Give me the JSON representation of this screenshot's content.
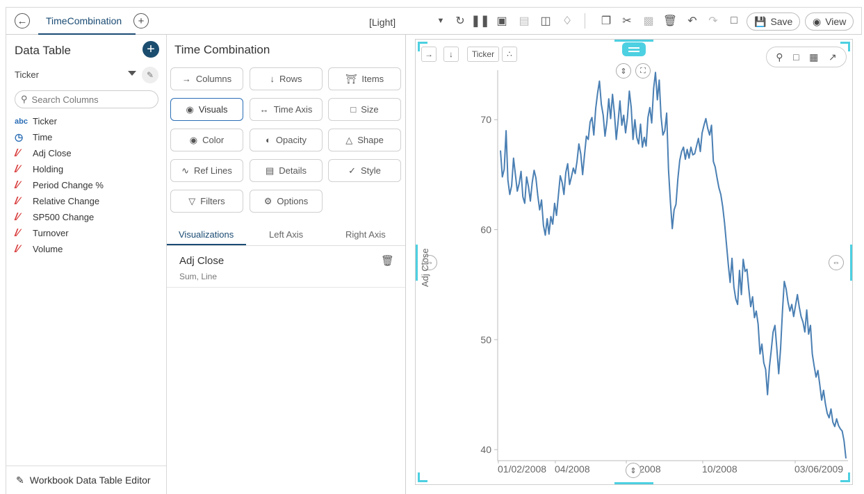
{
  "topbar": {
    "tab_label": "TimeCombination",
    "theme": "[Light]",
    "save_label": "Save",
    "view_label": "View"
  },
  "left_panel": {
    "title": "Data Table",
    "selected_table": "Ticker",
    "search_placeholder": "Search Columns",
    "columns": [
      {
        "type": "abc",
        "name": "Ticker"
      },
      {
        "type": "time",
        "name": "Time"
      },
      {
        "type": "num",
        "name": "Adj Close"
      },
      {
        "type": "num",
        "name": "Holding"
      },
      {
        "type": "num",
        "name": "Period Change %"
      },
      {
        "type": "num",
        "name": "Relative Change"
      },
      {
        "type": "num",
        "name": "SP500 Change"
      },
      {
        "type": "num",
        "name": "Turnover"
      },
      {
        "type": "num",
        "name": "Volume"
      }
    ],
    "footer": "Workbook Data Table Editor"
  },
  "mid_panel": {
    "title": "Time Combination",
    "buttons": {
      "columns": "Columns",
      "rows": "Rows",
      "items": "Items",
      "visuals": "Visuals",
      "time_axis": "Time Axis",
      "size": "Size",
      "color": "Color",
      "opacity": "Opacity",
      "shape": "Shape",
      "ref_lines": "Ref Lines",
      "details": "Details",
      "style": "Style",
      "filters": "Filters",
      "options": "Options"
    },
    "tabs": [
      "Visualizations",
      "Left Axis",
      "Right Axis"
    ],
    "visualization": {
      "name": "Adj Close",
      "sub": "Sum, Line"
    }
  },
  "chart_panel": {
    "ticker_label": "Ticker",
    "accent_color": "#4dd0e1",
    "line_color": "#4a7fb3"
  },
  "chart_data": {
    "type": "line",
    "ylabel": "Adj Close",
    "ylim": [
      39,
      74.5
    ],
    "yticks": [
      "40",
      "50",
      "60",
      "70"
    ],
    "xticks": [
      "01/02/2008",
      "04/2008",
      "07/2008",
      "10/2008",
      "03/06/2009"
    ],
    "series": [
      {
        "values": [
          67.2,
          64.8,
          65.5,
          69,
          64.5,
          63.2,
          64,
          66.5,
          65,
          63.5,
          64.2,
          65.3,
          63,
          62.4,
          64.8,
          63.9,
          62.6,
          64.3,
          65.4,
          64.7,
          63.1,
          61.8,
          62.7,
          60.4,
          59.5,
          61,
          59.6,
          61.2,
          60.5,
          62.4,
          61.3,
          63.1,
          64.9,
          64.3,
          63.2,
          65.2,
          66,
          64.1,
          64.8,
          65.6,
          65.1,
          66.2,
          67.8,
          66.9,
          65,
          66.8,
          68.5,
          68.2,
          69.8,
          70.2,
          68.6,
          71,
          72.4,
          73.5,
          71.4,
          70.4,
          68.5,
          69.8,
          71.9,
          70.1,
          72.3,
          70.6,
          68.2,
          69.8,
          71.7,
          69.5,
          70.4,
          68.8,
          70.2,
          72.6,
          71.1,
          68.2,
          70,
          68.4,
          67.8,
          69.6,
          67.5,
          68.4,
          67.6,
          70.2,
          71.1,
          69.7,
          72.8,
          74.3,
          71.8,
          73.6,
          70.3,
          68.6,
          69,
          70.6,
          65.4,
          62.5,
          60.1,
          61.8,
          62.3,
          64.6,
          66.3,
          67.1,
          67.5,
          66.4,
          67.3,
          66.5,
          67.5,
          66.8,
          66.9,
          67.6,
          68.3,
          67.1,
          68.8,
          69.5,
          70.1,
          69.2,
          68.6,
          69.5,
          66.2,
          65.7,
          64.7,
          63.8,
          63.2,
          62.1,
          60.6,
          58.7,
          56.8,
          55.2,
          57.4,
          54.8,
          53.7,
          53.2,
          56.3,
          54.1,
          57.3,
          56.2,
          56.4,
          54.6,
          53,
          53.9,
          52,
          52.6,
          51.4,
          48.7,
          49.6,
          47.9,
          47.3,
          45,
          47.5,
          49,
          50.7,
          51.3,
          49.2,
          46.9,
          49.2,
          52.6,
          55.3,
          54.6,
          53.4,
          52.6,
          53.2,
          52.1,
          53.1,
          54.1,
          53,
          52.1,
          51.6,
          50.7,
          52.7,
          50.5,
          51.3,
          48.7,
          47.6,
          46.6,
          47.2,
          45.9,
          44.5,
          45.4,
          44.2,
          43.3,
          42.9,
          43.7,
          42.5,
          42.1,
          42.8,
          42.2,
          41.9,
          41.7,
          40.8,
          39.2
        ]
      }
    ]
  }
}
